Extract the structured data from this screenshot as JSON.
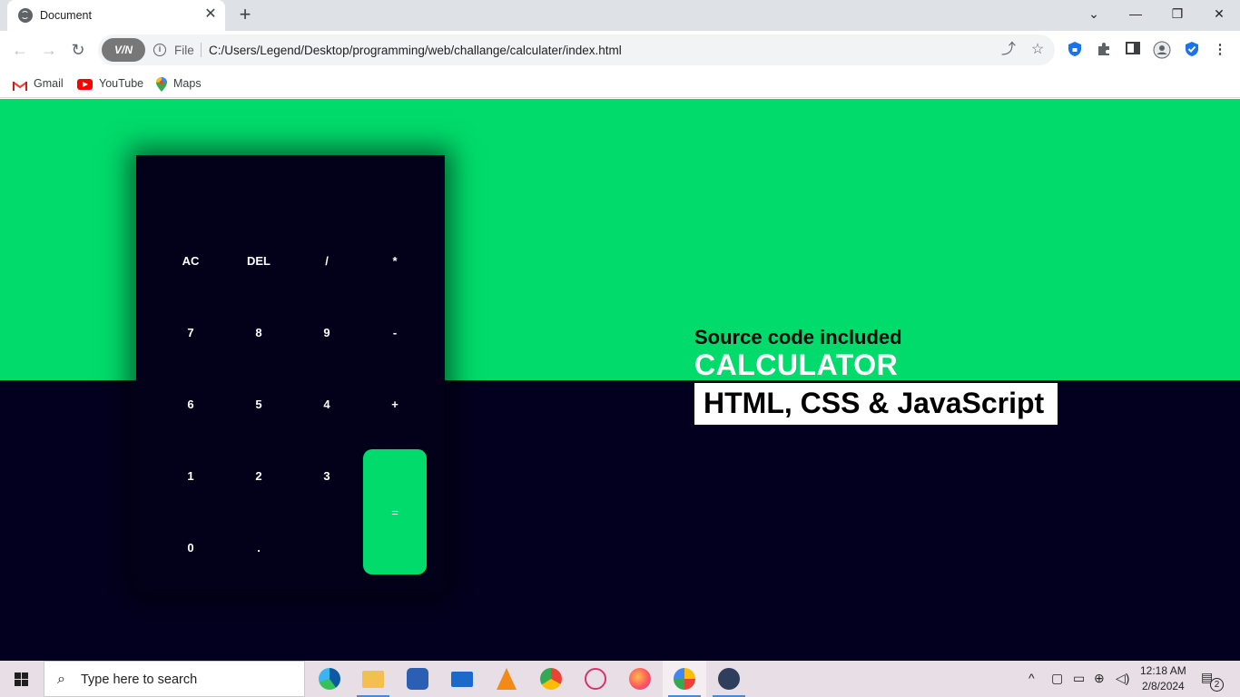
{
  "browser": {
    "tab_title": "Document",
    "scheme": "File",
    "url": "C:/Users/Legend/Desktop/programming/web/challange/calculater/index.html",
    "vpn_badge": "V/N",
    "bookmarks": [
      {
        "label": "Gmail",
        "icon": "gmail-icon"
      },
      {
        "label": "YouTube",
        "icon": "youtube-icon"
      },
      {
        "label": "Maps",
        "icon": "maps-icon"
      }
    ]
  },
  "page": {
    "colors": {
      "accent": "#00db6b",
      "dark": "#03001f",
      "calc_bg": "#03001a"
    },
    "calculator": {
      "display_value": "",
      "keys": {
        "ac": "AC",
        "del": "DEL",
        "divide": "/",
        "multiply": "*",
        "seven": "7",
        "eight": "8",
        "nine": "9",
        "minus": "-",
        "six": "6",
        "five": "5",
        "four": "4",
        "plus": "+",
        "one": "1",
        "two": "2",
        "three": "3",
        "equals": "=",
        "zero": "0",
        "dot": "."
      }
    },
    "promo": {
      "subtitle": "Source code included",
      "title": "CALCULATOR",
      "tech": "HTML, CSS & JavaScript"
    }
  },
  "taskbar": {
    "search_placeholder": "Type here to search",
    "time": "12:18 AM",
    "date": "2/8/2024",
    "notification_count": "2",
    "apps": [
      "edge",
      "file-explorer",
      "microsoft-store",
      "mail",
      "vlc",
      "chrome",
      "snipping-tool",
      "firefox",
      "brave",
      "winamp"
    ]
  }
}
